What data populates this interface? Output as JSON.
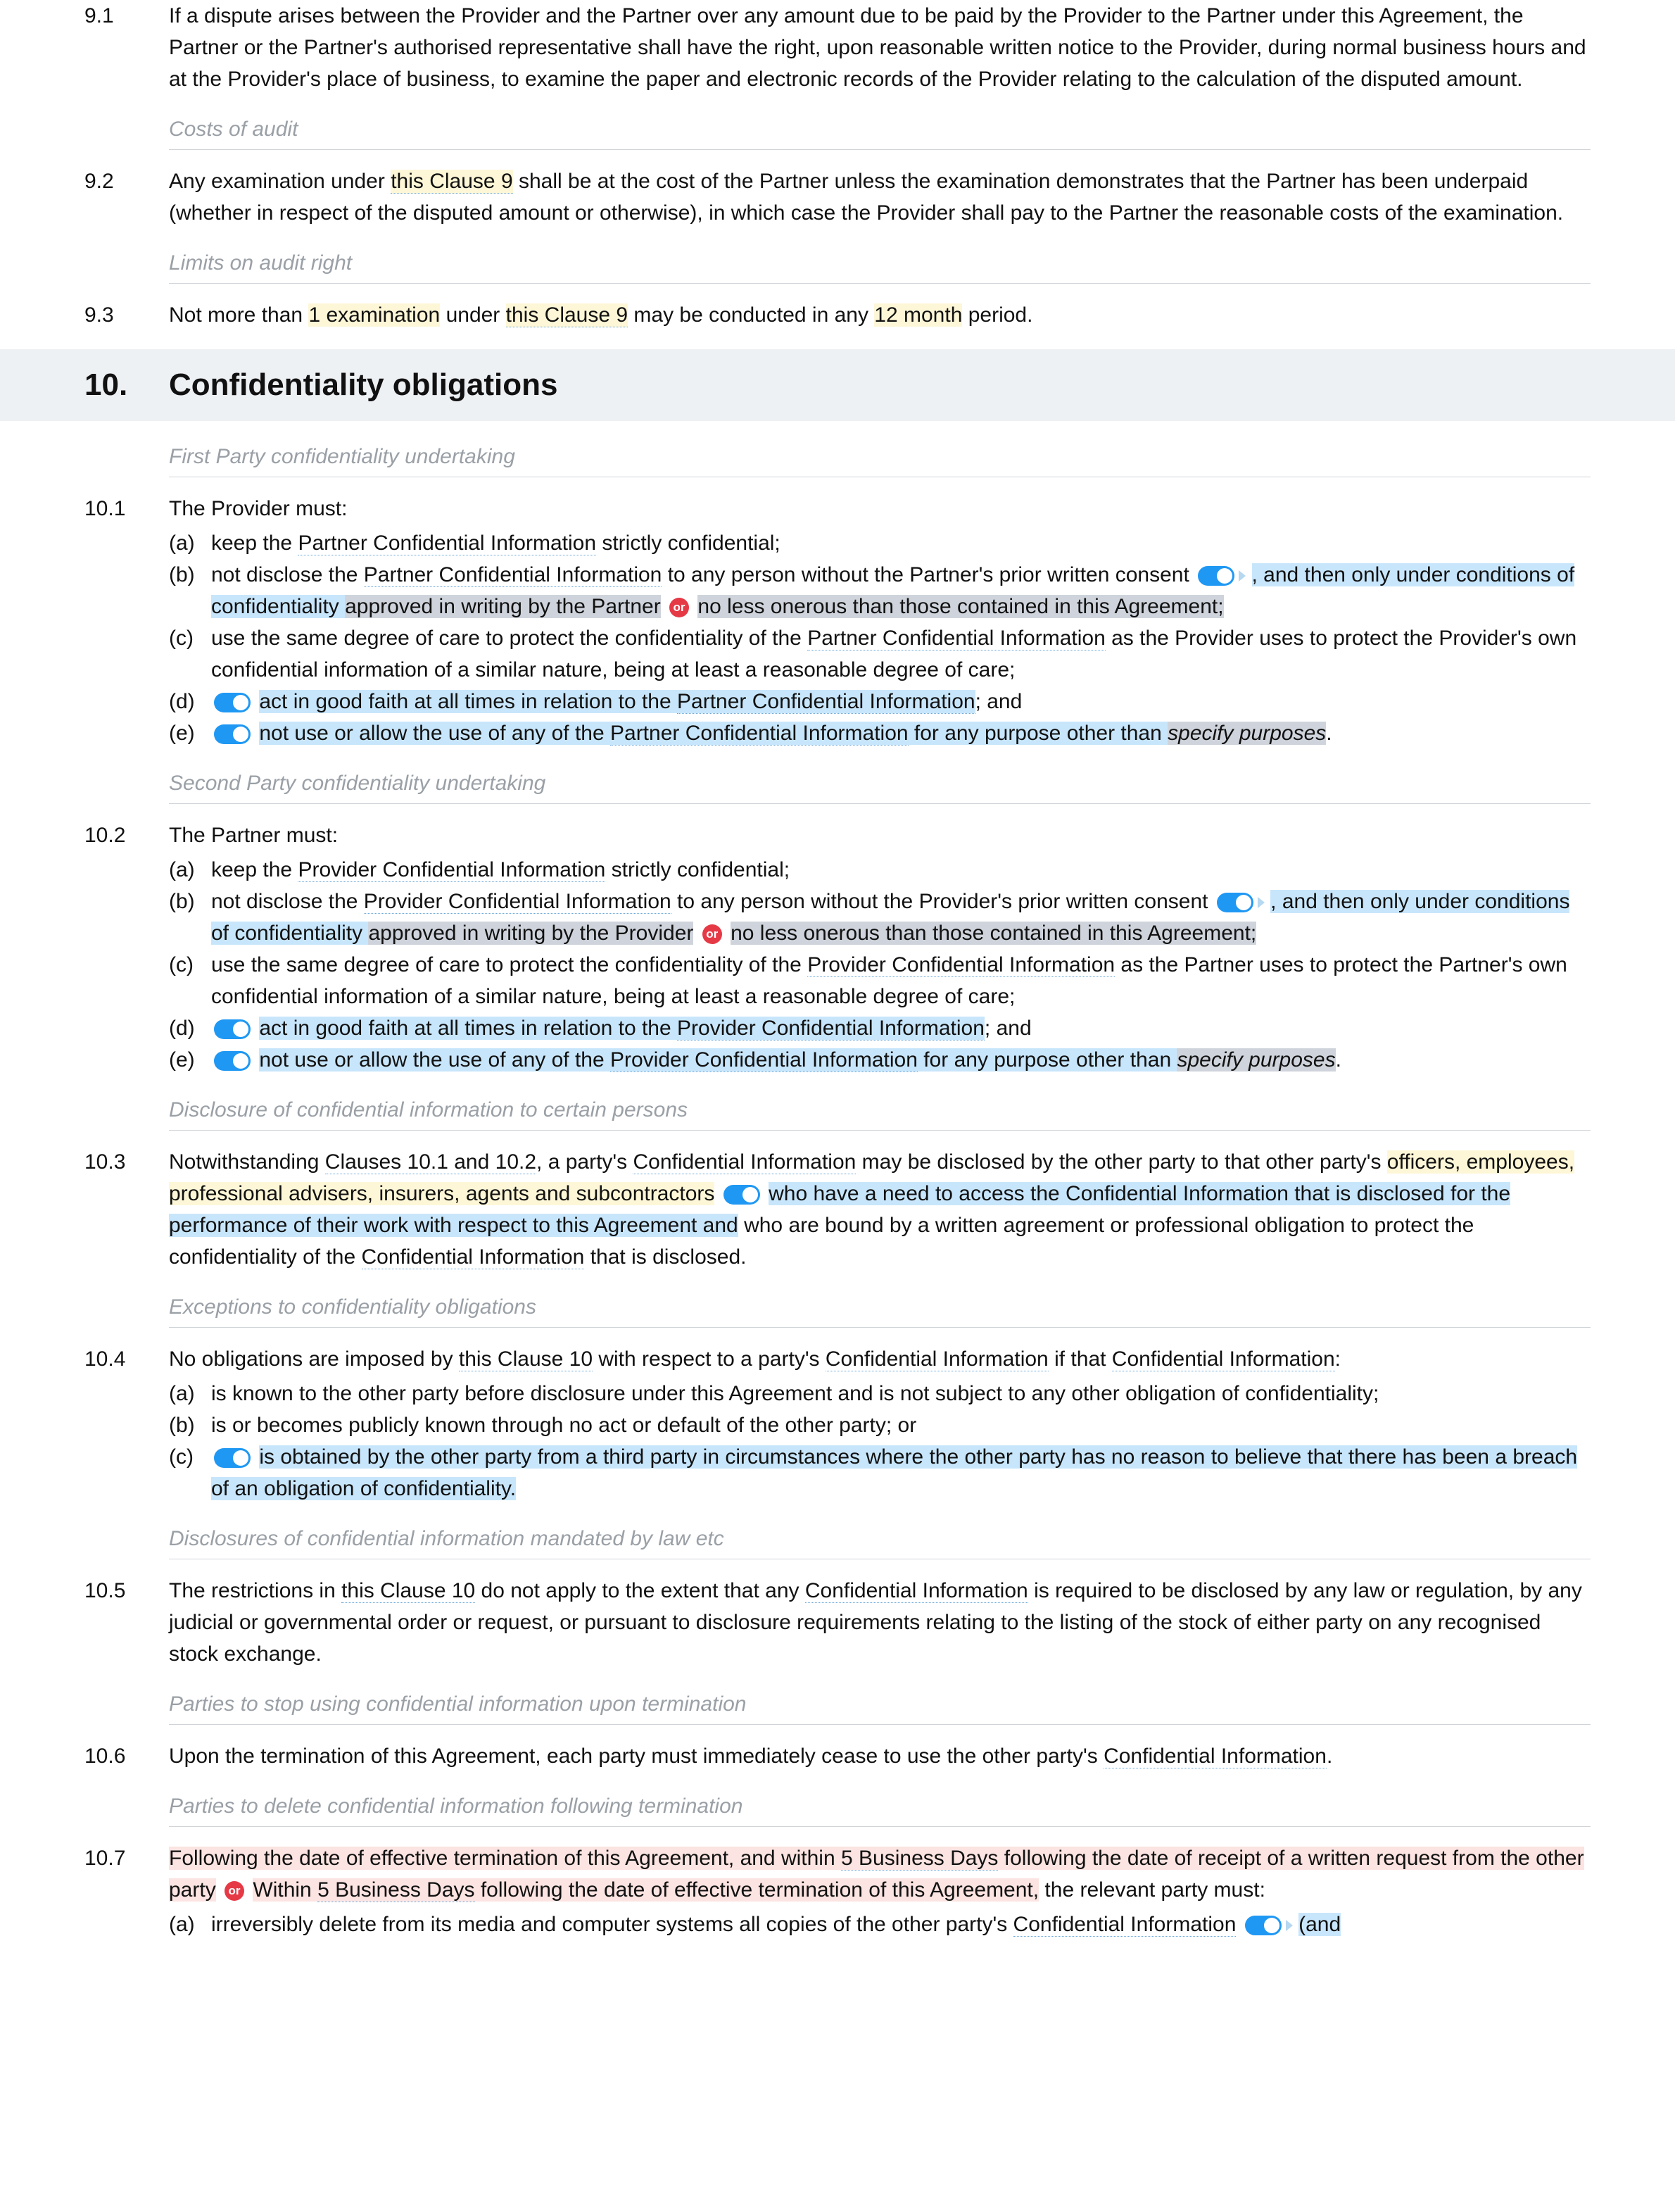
{
  "c91": {
    "num": "9.1",
    "text1": "If a dispute arises between the Provider and the Partner over any amount due to be paid by the Provider to the Partner under this Agreement, the Partner or the Partner's authorised representative shall have the right, upon reasonable written notice to the Provider, during normal business hours and at the Provider's place of business, to examine the paper and electronic records of the Provider relating to the calculation of the disputed amount."
  },
  "sub_costs": "Costs of audit",
  "c92": {
    "num": "9.2",
    "t1": "Any examination under ",
    "link1": "this Clause 9",
    "t2": " shall be at the cost of the Partner unless the examination demonstrates that the Partner has been underpaid (whether in respect of the disputed amount or otherwise), in which case the Provider shall pay to the Partner the reasonable costs of the examination."
  },
  "sub_limits": "Limits on audit right",
  "c93": {
    "num": "9.3",
    "t1": "Not more than ",
    "hl1": "1 examination",
    "t2": " under ",
    "link1": "this Clause 9",
    "t3": " may be conducted in any ",
    "hl2": "12 month",
    "t4": " period."
  },
  "sec10": {
    "num": "10.",
    "title": "Confidentiality obligations"
  },
  "sub_fpcu": "First Party confidentiality undertaking",
  "c101": {
    "num": "10.1",
    "lead": "The Provider must:",
    "a_l": "(a)",
    "a1": "keep the ",
    "a_link": "Partner Confidential Information",
    "a2": " strictly confidential;",
    "b_l": "(b)",
    "b1": "not disclose the ",
    "b_link": "Partner Confidential Information",
    "b2": " to any person without the Partner's prior written consent",
    "b_hlb1": ", and then only under conditions of confidentiality ",
    "b_hlg1": "approved in writing by the Partner",
    "or": "or",
    "b_hlg2": "no less onerous than those contained in this Agreement;",
    "c_l": "(c)",
    "c1": "use the same degree of care to protect the confidentiality of the ",
    "c_link": "Partner Confidential Information",
    "c2": " as the Provider uses to protect the Provider's own confidential information of a similar nature, being at least a reasonable degree of care;",
    "d_l": "(d)",
    "d1": "act in good faith at all times in relation to the ",
    "d_link": "Partner Confidential Information",
    "d2": "; and",
    "e_l": "(e)",
    "e1": "not use or allow the use of any of the ",
    "e_link": "Partner Confidential Information",
    "e2": " for any purpose other than ",
    "e_sp": "specify purposes",
    "e3": "."
  },
  "sub_spcu": "Second Party confidentiality undertaking",
  "c102": {
    "num": "10.2",
    "lead": "The Partner must:",
    "a_l": "(a)",
    "a1": "keep the ",
    "a_link": "Provider Confidential Information",
    "a2": " strictly confidential;",
    "b_l": "(b)",
    "b1": "not disclose the ",
    "b_link": "Provider Confidential Information",
    "b2": " to any person without the Provider's prior written consent",
    "b_hlb1": ", and then only under conditions of confidentiality ",
    "b_hlg1": "approved in writing by the Provider",
    "or": "or",
    "b_hlg2": "no less onerous than those contained in this Agreement;",
    "c_l": "(c)",
    "c1": "use the same degree of care to protect the confidentiality of the ",
    "c_link": "Provider Confidential Information",
    "c2": " as the Partner uses to protect the Partner's own confidential information of a similar nature, being at least a reasonable degree of care;",
    "d_l": "(d)",
    "d1": "act in good faith at all times in relation to the ",
    "d_link": "Provider Confidential Information",
    "d2": "; and",
    "e_l": "(e)",
    "e1": "not use or allow the use of any of the ",
    "e_link": "Provider Confidential Information",
    "e2": " for any purpose other than ",
    "e_sp": "specify purposes",
    "e3": "."
  },
  "sub_disc": "Disclosure of confidential information to certain persons",
  "c103": {
    "num": "10.3",
    "t1": "Notwithstanding ",
    "link1": "Clauses 10.1 and 10.2",
    "t2": ", a party's ",
    "link2": "Confidential Information",
    "t3": " may be disclosed by the other party to that other party's ",
    "hl1": "officers, employees, professional advisers, insurers, agents and subcontractors",
    "hlb1": "who have a need to access the Confidential Information that is disclosed for the performance of their work with respect to this Agreement and",
    "t4": " who are bound by a written agreement or professional obligation to protect the confidentiality of the ",
    "link3": "Confidential Information",
    "t5": " that is disclosed."
  },
  "sub_exc": "Exceptions to confidentiality obligations",
  "c104": {
    "num": "10.4",
    "lead1": "No obligations are imposed by ",
    "link1": "this Clause 10",
    "lead2": " with respect to a party's ",
    "link2": "Confidential Information",
    "lead3": " if that ",
    "link3": "Confidential Information",
    "lead4": ":",
    "a_l": "(a)",
    "a1": "is known to the other party before disclosure under this Agreement and is not subject to any other obligation of confidentiality;",
    "b_l": "(b)",
    "b1": "is or becomes publicly known through no act or default of the other party; or",
    "c_l": "(c)",
    "c1": "is obtained by the other party from a third party in circumstances where the other party has no reason to believe that there has been a breach of an obligation of confidentiality."
  },
  "sub_mand": "Disclosures of confidential information mandated by law etc",
  "c105": {
    "num": "10.5",
    "t1": "The restrictions in ",
    "link1": "this Clause 10",
    "t2": " do not apply to the extent that any ",
    "link2": "Confidential Information",
    "t3": " is required to be disclosed by any law or regulation, by any judicial or governmental order or request, or pursuant to disclosure requirements relating to the listing of the stock of either party on any recognised stock exchange."
  },
  "sub_stop": "Parties to stop using confidential information upon termination",
  "c106": {
    "num": "10.6",
    "t1": "Upon the termination of this Agreement, each party must immediately cease to use the other party's ",
    "link1": "Confidential Information",
    "t2": "."
  },
  "sub_del": "Parties to delete confidential information following termination",
  "c107": {
    "num": "10.7",
    "p1a": "Following the date of effective termination of this Agreement, and within ",
    "p1b": "5 Business Days",
    "p1c": " following the date of receipt of a written request from the other party",
    "or": "or",
    "p2a": "Within ",
    "p2b": "5 Business Days",
    "p2c": " following the date of effective termination of this Agreement,",
    "tail": " the relevant party must:",
    "a_l": "(a)",
    "a1": "irreversibly delete from its media and computer systems all copies of the other party's ",
    "a_link": "Confidential Information",
    "a2": "(and"
  }
}
